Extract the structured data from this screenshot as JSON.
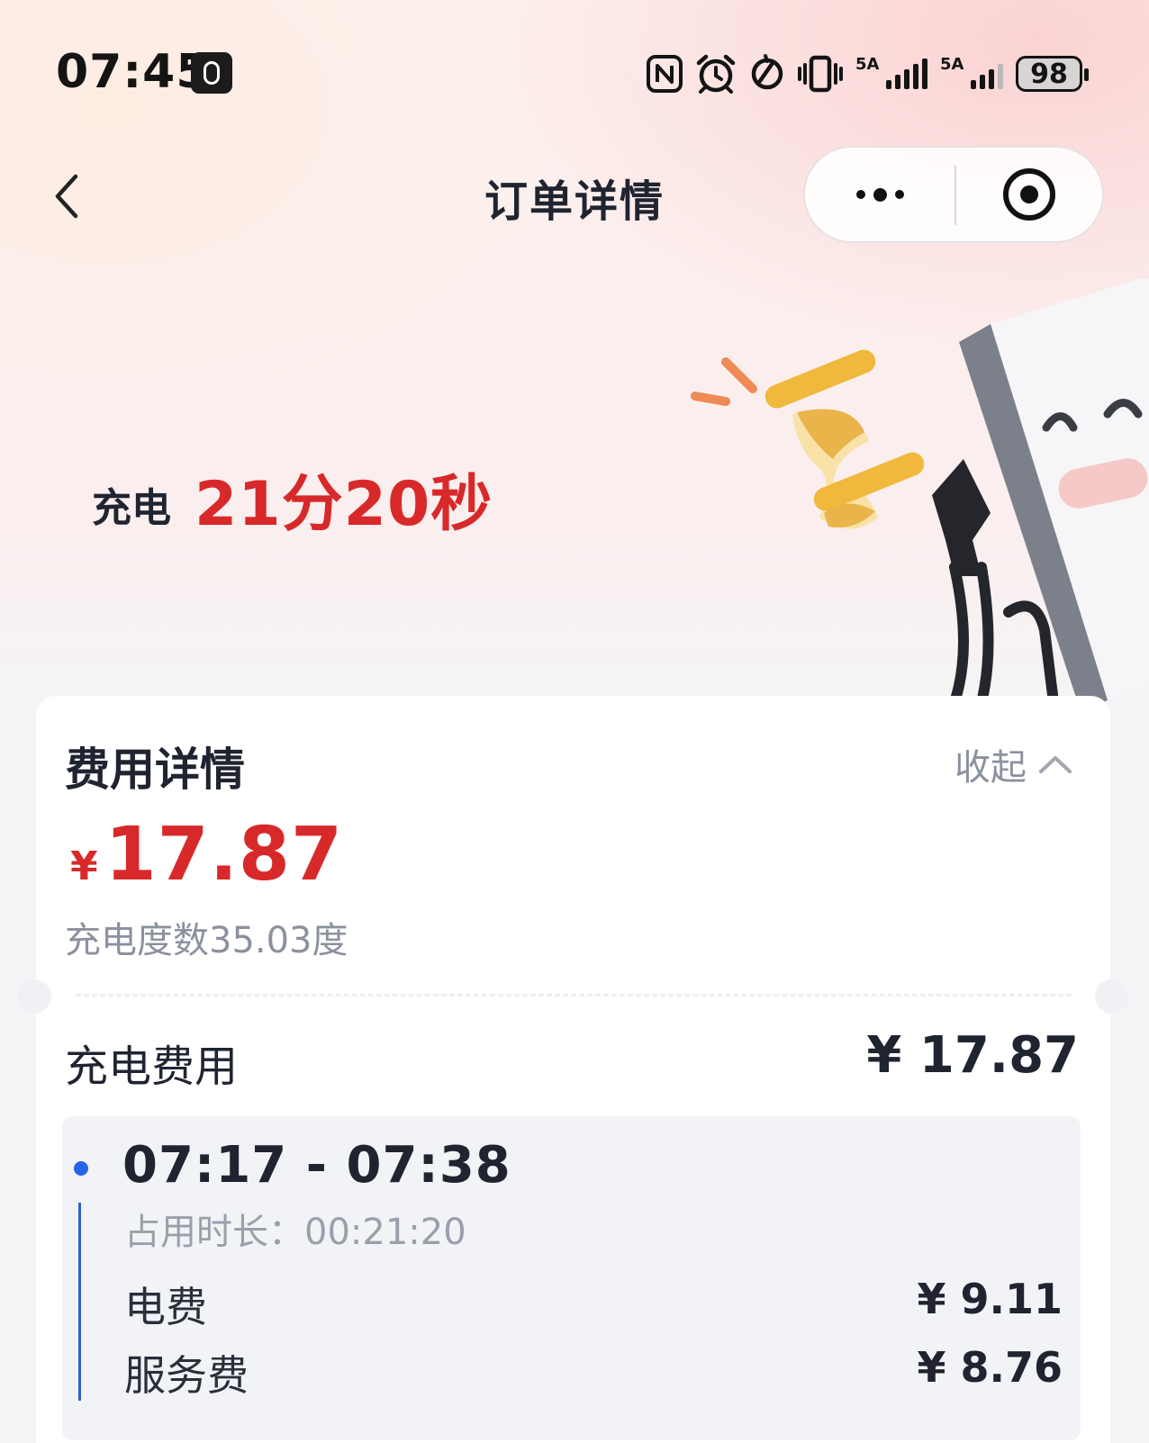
{
  "status_bar": {
    "time": "07:45",
    "signal1_label": "5A",
    "signal2_label": "5A",
    "battery": "98"
  },
  "nav": {
    "title": "订单详情"
  },
  "hero": {
    "duration_label": "充电",
    "duration_value": "21分20秒"
  },
  "fee_details": {
    "title": "费用详情",
    "collapse_label": "收起",
    "currency": "¥",
    "total": "17.87",
    "energy_text": "充电度数35.03度",
    "charging_fee_label": "充电费用",
    "charging_fee_value": "¥ 17.87",
    "period": {
      "time_range": "07:17 - 07:38",
      "occupy_text": "占用时长：00:21:20",
      "items": [
        {
          "label": "电费",
          "value": "¥ 9.11"
        },
        {
          "label": "服务费",
          "value": "¥ 8.76"
        }
      ]
    }
  },
  "colors": {
    "accent_red": "#d8292a",
    "timeline_blue": "#2563eb"
  }
}
